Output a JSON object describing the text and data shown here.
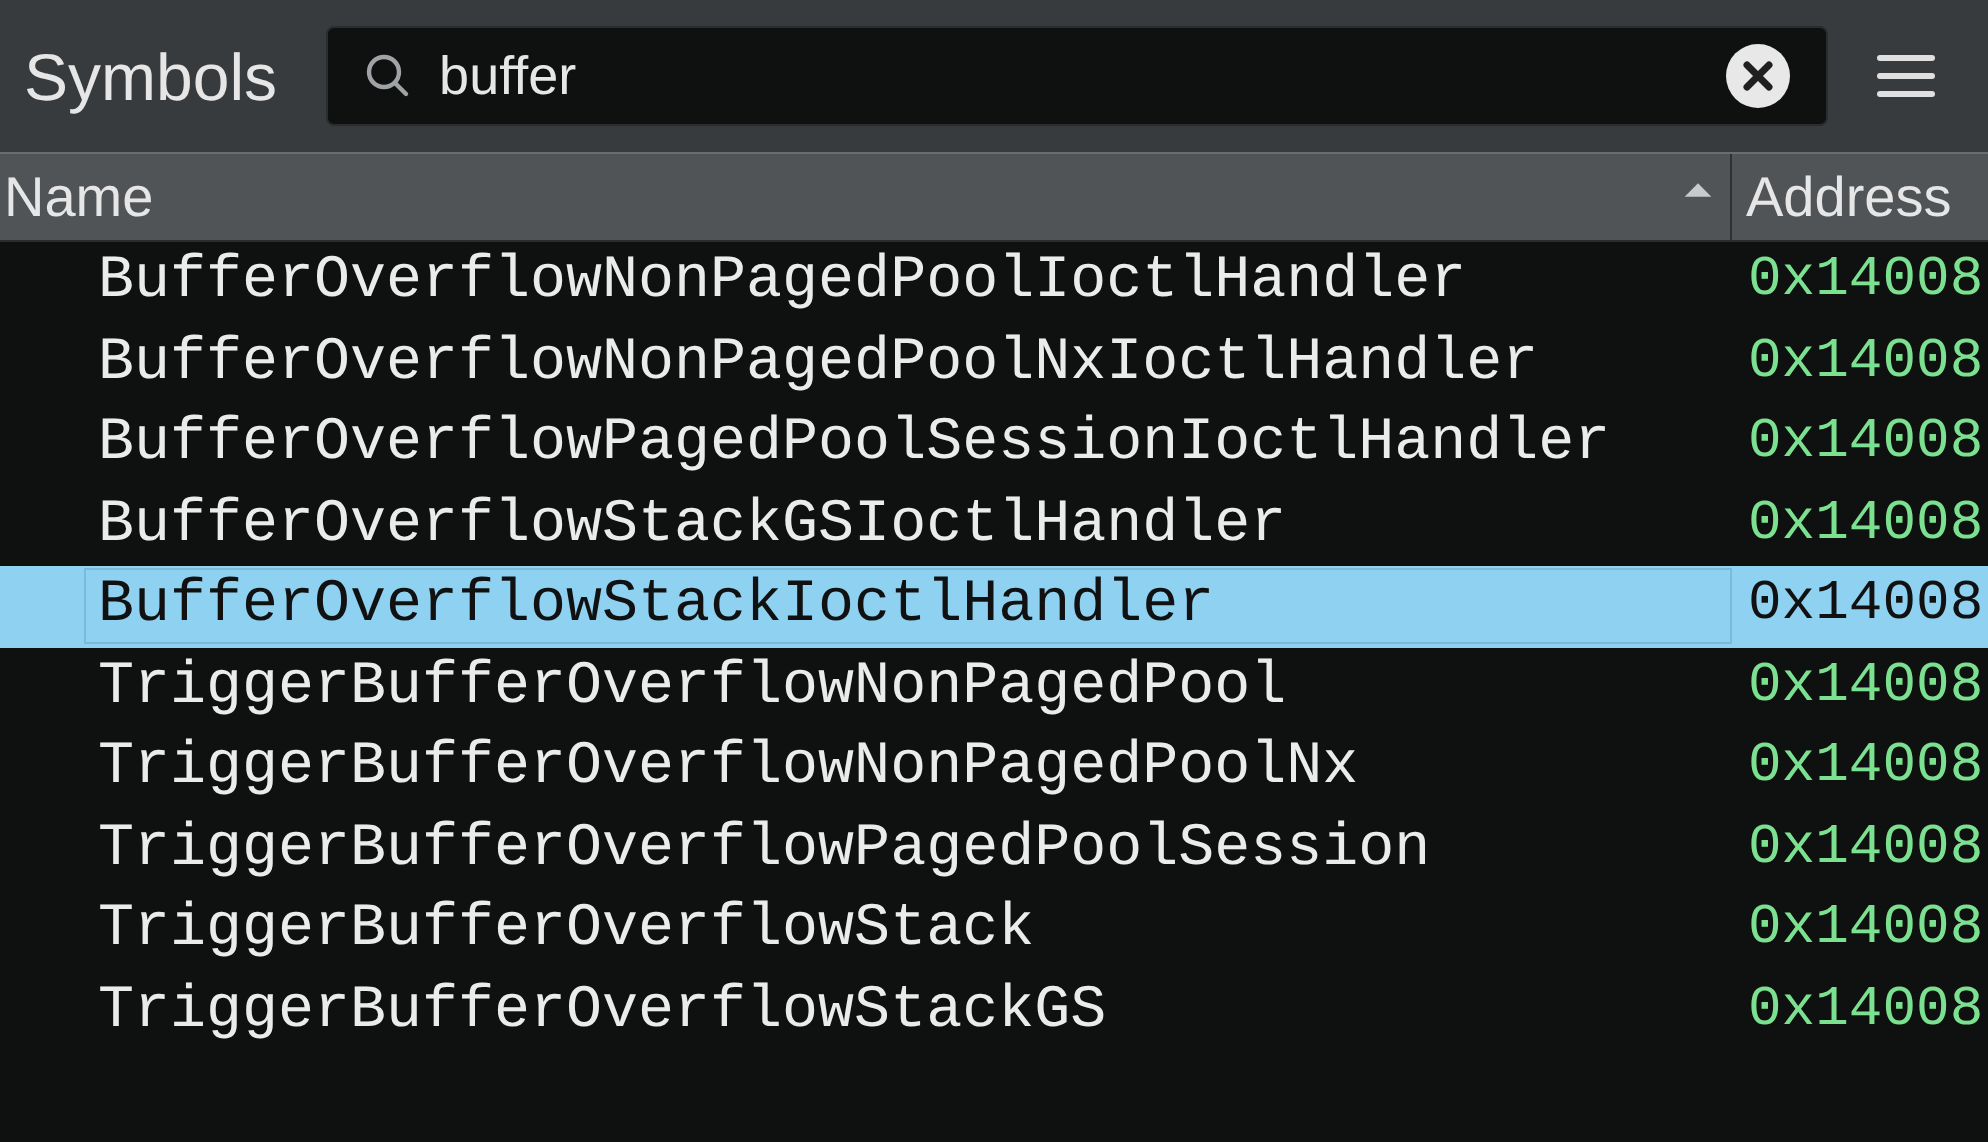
{
  "panel": {
    "title": "Symbols"
  },
  "search": {
    "value": "buffer"
  },
  "table": {
    "columns": [
      {
        "label": "Name",
        "sorted": true
      },
      {
        "label": "Address",
        "sorted": false
      }
    ],
    "rows": [
      {
        "name": "BufferOverflowNonPagedPoolIoctlHandler",
        "address": "0x14008",
        "selected": false
      },
      {
        "name": "BufferOverflowNonPagedPoolNxIoctlHandler",
        "address": "0x14008",
        "selected": false
      },
      {
        "name": "BufferOverflowPagedPoolSessionIoctlHandler",
        "address": "0x14008",
        "selected": false
      },
      {
        "name": "BufferOverflowStackGSIoctlHandler",
        "address": "0x14008",
        "selected": false
      },
      {
        "name": "BufferOverflowStackIoctlHandler",
        "address": "0x14008",
        "selected": true
      },
      {
        "name": "TriggerBufferOverflowNonPagedPool",
        "address": "0x14008",
        "selected": false
      },
      {
        "name": "TriggerBufferOverflowNonPagedPoolNx",
        "address": "0x14008",
        "selected": false
      },
      {
        "name": "TriggerBufferOverflowPagedPoolSession",
        "address": "0x14008",
        "selected": false
      },
      {
        "name": "TriggerBufferOverflowStack",
        "address": "0x14008",
        "selected": false
      },
      {
        "name": "TriggerBufferOverflowStackGS",
        "address": "0x14008",
        "selected": false
      }
    ]
  }
}
